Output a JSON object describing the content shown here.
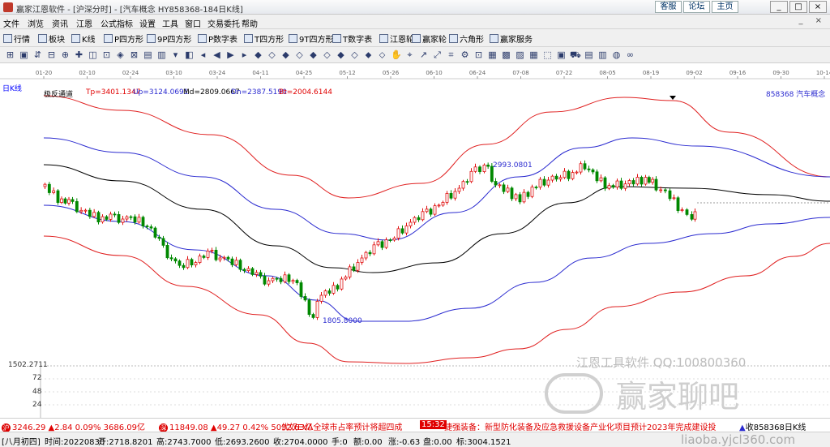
{
  "window": {
    "title": "赢家江恩软件 - [沪深分时] - [汽车概念  HY858368-184日K线]",
    "links": [
      "客服",
      "论坛",
      "主页"
    ],
    "controls": [
      "_",
      "□",
      "×"
    ]
  },
  "menu": {
    "items": [
      "文件",
      "浏览",
      "资讯",
      "江恩",
      "公式指标",
      "设置",
      "工具",
      "窗口",
      "交易委托",
      "帮助"
    ],
    "right": "_ ×"
  },
  "toolbar1": {
    "items": [
      {
        "icon": "grid-icon",
        "label": "行情"
      },
      {
        "icon": "blocks-icon",
        "label": "板块"
      },
      {
        "icon": "kline-icon",
        "label": "K线"
      },
      {
        "icon": "p-square-icon",
        "label": "P四方形"
      },
      {
        "icon": "9p-icon",
        "label": "9P四方形"
      },
      {
        "icon": "p-table-icon",
        "label": "P数字表"
      },
      {
        "icon": "t-square-icon",
        "label": "T四方形"
      },
      {
        "icon": "9t-icon",
        "label": "9T四方形"
      },
      {
        "icon": "t-table-icon",
        "label": "T数字表"
      },
      {
        "icon": "wheel-icon",
        "label": "江恩轮"
      },
      {
        "icon": "win-wheel-icon",
        "label": "赢家轮"
      },
      {
        "icon": "hexagon-icon",
        "label": "六角形"
      },
      {
        "icon": "service-icon",
        "label": "赢家服务"
      }
    ]
  },
  "toolbar2": {
    "glyphs": [
      "⊞",
      "▣",
      "⇵",
      "⊟",
      "⊕",
      "✚",
      "◫",
      "⊡",
      "◈",
      "⊠",
      "▤",
      "▥",
      "▾",
      "◧",
      "◂",
      "◀",
      "▶",
      "▸",
      "◆",
      "◇",
      "◆",
      "◇",
      "◆",
      "◇",
      "◆",
      "◇",
      "⬥",
      "⬦",
      "✋",
      "⌖",
      "↗",
      "⤢",
      "⌗",
      "⚙",
      "⊡",
      "▦",
      "▩",
      "▨",
      "▦",
      "⬚",
      "▣",
      "⛟",
      "▤",
      "▥",
      "◍",
      "∞"
    ]
  },
  "chart": {
    "period_label": "日K线",
    "dates": [
      "01-20",
      "02-10",
      "02-24",
      "03-10",
      "03-24",
      "04-11",
      "04-25",
      "05-12",
      "05-26",
      "06-10",
      "06-24",
      "07-08",
      "07-22",
      "08-05",
      "08-19",
      "09-02",
      "09-16",
      "09-30",
      "10-14"
    ],
    "indicator": {
      "name": "极反通道",
      "tp": "Tp=3401.1347",
      "up": "Up=3124.0691",
      "md": "Md=2809.0667",
      "dn": "Dn=2387.5190",
      "bt": "Bt=2004.6144"
    },
    "code_label": "858368  汽车概念",
    "annotation_high": "2993.0801",
    "annotation_low": "1805.8000",
    "volume_top": "1502.2711",
    "volume_ticks": [
      "72",
      "48",
      "24"
    ],
    "colors": {
      "up": "#e01010",
      "down": "#008800",
      "upper": "#e02020",
      "mid": "#2b2bd0",
      "center": "#000000"
    }
  },
  "watermark": {
    "line1": "江恩工具软件  QQ:100800360",
    "logo_text": "赢家聊吧",
    "url": "liaoba.yjcl360.com"
  },
  "status": {
    "sh_index": "3246.29",
    "sh_change": "▲2.84 0.09% 3686.09亿",
    "sz_index": "11849.08",
    "sz_change": "▲49.27 0.42% 5032.63亿",
    "ticker1": "优奴EVA全球市占率预计将超四成",
    "ticker_time": "15:32",
    "ticker2": "捷强装备：新型防化装备及应急救援设备产业化项目预计2023年完成建设投",
    "right_label": "收858368日K线"
  },
  "infobar": {
    "lunar": "[八月初四]",
    "time": "时间:20220830",
    "open": "开:2718.8201",
    "high": "高:2743.7000",
    "low": "低:2693.2600",
    "close": "收:2704.0000",
    "hand": "手:0",
    "amount": "额:0.00",
    "change": "涨:-0.63",
    "vol": "盘:0.00",
    "mark": "标:3004.1521"
  }
}
